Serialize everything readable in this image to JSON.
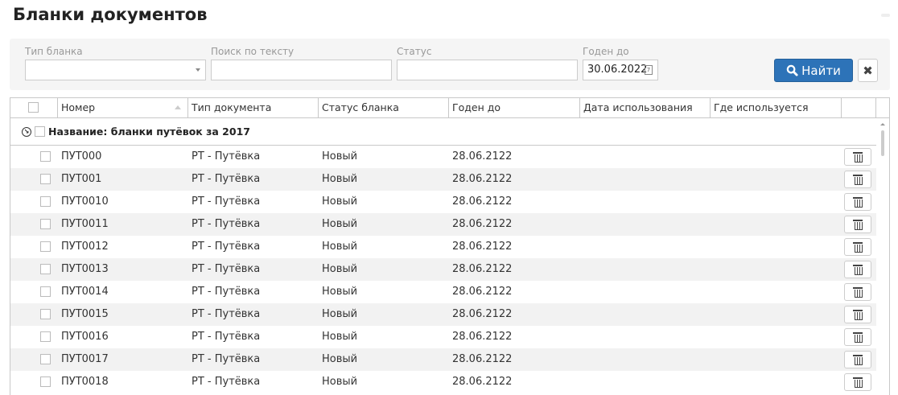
{
  "title": "Бланки документов",
  "filters": {
    "type_label": "Тип бланка",
    "type_value": "",
    "search_label": "Поиск по тексту",
    "search_value": "",
    "status_label": "Статус",
    "status_value": "",
    "valid_label": "Годен до",
    "valid_value": "30.06.2022",
    "find_label": "Найти"
  },
  "columns": [
    "Номер",
    "Тип документа",
    "Статус бланка",
    "Годен до",
    "Дата использования",
    "Где используется"
  ],
  "group_label": "Название: бланки путёвок за 2017",
  "rows": [
    {
      "number": "ПУТ000",
      "type": "РТ - Путёвка",
      "status": "Новый",
      "valid": "28.06.2122",
      "used": "",
      "where": ""
    },
    {
      "number": "ПУТ001",
      "type": "РТ - Путёвка",
      "status": "Новый",
      "valid": "28.06.2122",
      "used": "",
      "where": ""
    },
    {
      "number": "ПУТ0010",
      "type": "РТ - Путёвка",
      "status": "Новый",
      "valid": "28.06.2122",
      "used": "",
      "where": ""
    },
    {
      "number": "ПУТ0011",
      "type": "РТ - Путёвка",
      "status": "Новый",
      "valid": "28.06.2122",
      "used": "",
      "where": ""
    },
    {
      "number": "ПУТ0012",
      "type": "РТ - Путёвка",
      "status": "Новый",
      "valid": "28.06.2122",
      "used": "",
      "where": ""
    },
    {
      "number": "ПУТ0013",
      "type": "РТ - Путёвка",
      "status": "Новый",
      "valid": "28.06.2122",
      "used": "",
      "where": ""
    },
    {
      "number": "ПУТ0014",
      "type": "РТ - Путёвка",
      "status": "Новый",
      "valid": "28.06.2122",
      "used": "",
      "where": ""
    },
    {
      "number": "ПУТ0015",
      "type": "РТ - Путёвка",
      "status": "Новый",
      "valid": "28.06.2122",
      "used": "",
      "where": ""
    },
    {
      "number": "ПУТ0016",
      "type": "РТ - Путёвка",
      "status": "Новый",
      "valid": "28.06.2122",
      "used": "",
      "where": ""
    },
    {
      "number": "ПУТ0017",
      "type": "РТ - Путёвка",
      "status": "Новый",
      "valid": "28.06.2122",
      "used": "",
      "where": ""
    },
    {
      "number": "ПУТ0018",
      "type": "РТ - Путёвка",
      "status": "Новый",
      "valid": "28.06.2122",
      "used": "",
      "where": ""
    }
  ]
}
